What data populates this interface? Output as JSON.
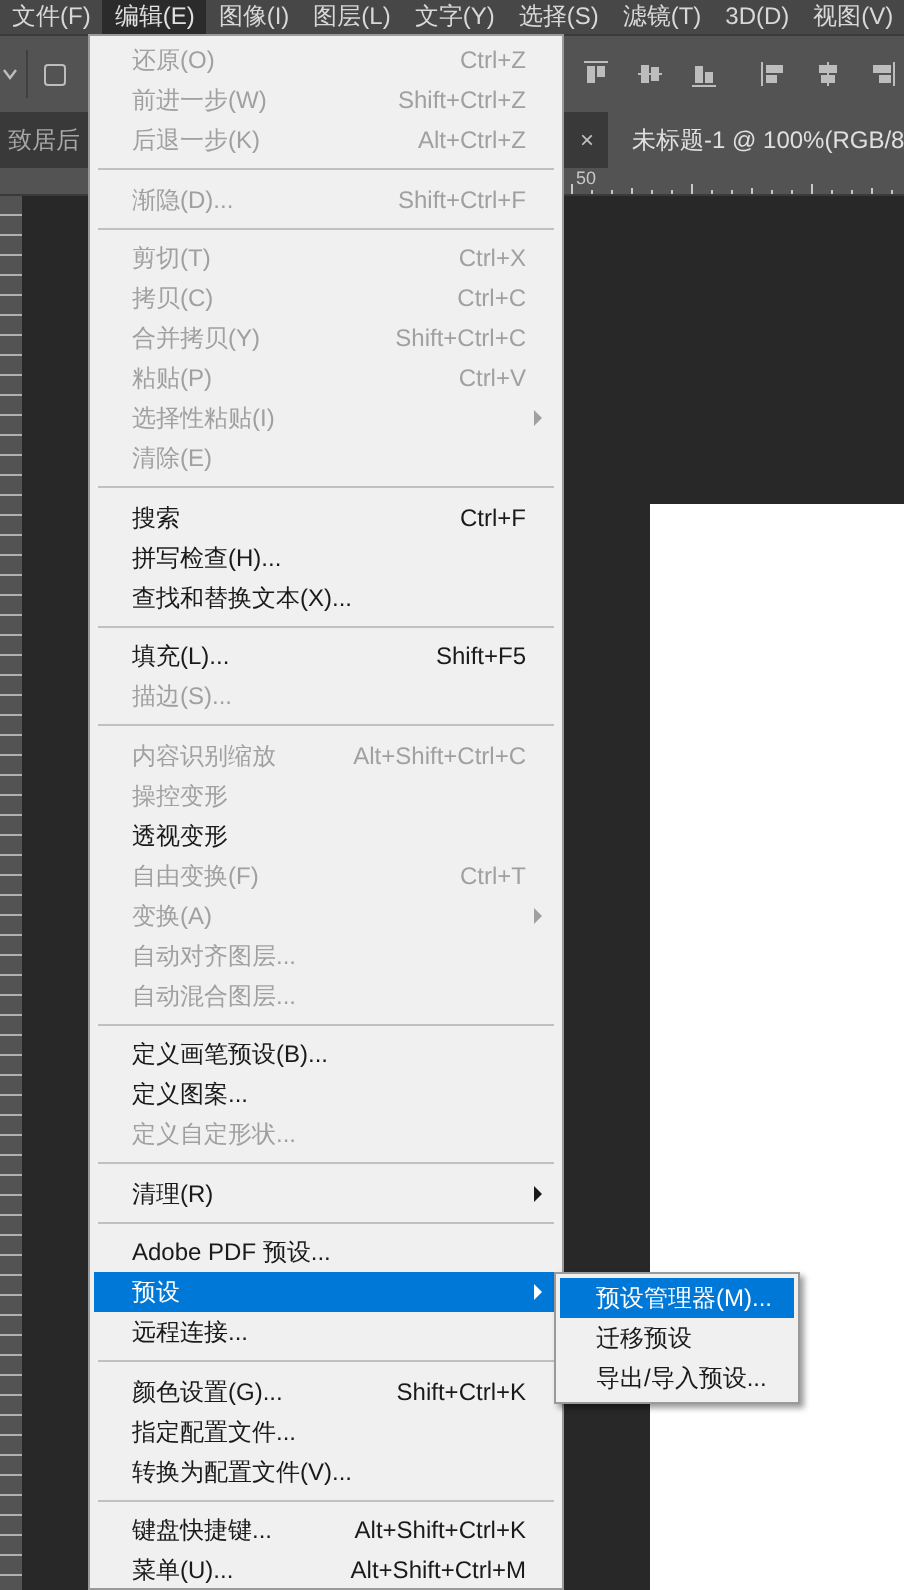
{
  "menubar": [
    {
      "label": "文件(F)",
      "selected": false
    },
    {
      "label": "编辑(E)",
      "selected": true
    },
    {
      "label": "图像(I)",
      "selected": false
    },
    {
      "label": "图层(L)",
      "selected": false
    },
    {
      "label": "文字(Y)",
      "selected": false
    },
    {
      "label": "选择(S)",
      "selected": false
    },
    {
      "label": "滤镜(T)",
      "selected": false
    },
    {
      "label": "3D(D)",
      "selected": false
    },
    {
      "label": "视图(V)",
      "selected": false
    }
  ],
  "options_bar": {
    "checkbox": {
      "checked": false
    }
  },
  "tabs": [
    {
      "label": "致居后",
      "selected": false,
      "close": "×"
    },
    {
      "label": "未标题-1 @ 100%(RGB/8",
      "selected": true
    }
  ],
  "ruler": {
    "label": "50"
  },
  "edit_menu": [
    {
      "kind": "item",
      "label": "还原(O)",
      "shortcut": "Ctrl+Z",
      "disabled": true
    },
    {
      "kind": "item",
      "label": "前进一步(W)",
      "shortcut": "Shift+Ctrl+Z",
      "disabled": true
    },
    {
      "kind": "item",
      "label": "后退一步(K)",
      "shortcut": "Alt+Ctrl+Z",
      "disabled": true
    },
    {
      "kind": "separator"
    },
    {
      "kind": "item",
      "label": "渐隐(D)...",
      "shortcut": "Shift+Ctrl+F",
      "disabled": true
    },
    {
      "kind": "separator"
    },
    {
      "kind": "item",
      "label": "剪切(T)",
      "shortcut": "Ctrl+X",
      "disabled": true
    },
    {
      "kind": "item",
      "label": "拷贝(C)",
      "shortcut": "Ctrl+C",
      "disabled": true
    },
    {
      "kind": "item",
      "label": "合并拷贝(Y)",
      "shortcut": "Shift+Ctrl+C",
      "disabled": true
    },
    {
      "kind": "item",
      "label": "粘贴(P)",
      "shortcut": "Ctrl+V",
      "disabled": true
    },
    {
      "kind": "item",
      "label": "选择性粘贴(I)",
      "disabled": true,
      "submenu": true
    },
    {
      "kind": "item",
      "label": "清除(E)",
      "disabled": true
    },
    {
      "kind": "separator"
    },
    {
      "kind": "item",
      "label": "搜索",
      "shortcut": "Ctrl+F",
      "disabled": false
    },
    {
      "kind": "item",
      "label": "拼写检查(H)...",
      "disabled": false
    },
    {
      "kind": "item",
      "label": "查找和替换文本(X)...",
      "disabled": false
    },
    {
      "kind": "separator"
    },
    {
      "kind": "item",
      "label": "填充(L)...",
      "shortcut": "Shift+F5",
      "disabled": false
    },
    {
      "kind": "item",
      "label": "描边(S)...",
      "disabled": true
    },
    {
      "kind": "separator"
    },
    {
      "kind": "item",
      "label": "内容识别缩放",
      "shortcut": "Alt+Shift+Ctrl+C",
      "disabled": true
    },
    {
      "kind": "item",
      "label": "操控变形",
      "disabled": true
    },
    {
      "kind": "item",
      "label": "透视变形",
      "disabled": false
    },
    {
      "kind": "item",
      "label": "自由变换(F)",
      "shortcut": "Ctrl+T",
      "disabled": true
    },
    {
      "kind": "item",
      "label": "变换(A)",
      "disabled": true,
      "submenu": true
    },
    {
      "kind": "item",
      "label": "自动对齐图层...",
      "disabled": true
    },
    {
      "kind": "item",
      "label": "自动混合图层...",
      "disabled": true
    },
    {
      "kind": "separator"
    },
    {
      "kind": "item",
      "label": "定义画笔预设(B)...",
      "disabled": false
    },
    {
      "kind": "item",
      "label": "定义图案...",
      "disabled": false
    },
    {
      "kind": "item",
      "label": "定义自定形状...",
      "disabled": true
    },
    {
      "kind": "separator"
    },
    {
      "kind": "item",
      "label": "清理(R)",
      "disabled": false,
      "submenu": true
    },
    {
      "kind": "separator"
    },
    {
      "kind": "item",
      "label": "Adobe PDF 预设...",
      "disabled": false
    },
    {
      "kind": "item",
      "label": "预设",
      "disabled": false,
      "submenu": true,
      "selected": true
    },
    {
      "kind": "item",
      "label": "远程连接...",
      "disabled": false
    },
    {
      "kind": "separator"
    },
    {
      "kind": "item",
      "label": "颜色设置(G)...",
      "shortcut": "Shift+Ctrl+K",
      "disabled": false
    },
    {
      "kind": "item",
      "label": "指定配置文件...",
      "disabled": false
    },
    {
      "kind": "item",
      "label": "转换为配置文件(V)...",
      "disabled": false
    },
    {
      "kind": "separator"
    },
    {
      "kind": "item",
      "label": "键盘快捷键...",
      "shortcut": "Alt+Shift+Ctrl+K",
      "disabled": false
    },
    {
      "kind": "item",
      "label": "菜单(U)...",
      "shortcut": "Alt+Shift+Ctrl+M",
      "disabled": false
    }
  ],
  "submenu": [
    {
      "label": "预设管理器(M)...",
      "selected": true
    },
    {
      "label": "迁移预设",
      "selected": false
    },
    {
      "label": "导出/导入预设...",
      "selected": false
    }
  ]
}
